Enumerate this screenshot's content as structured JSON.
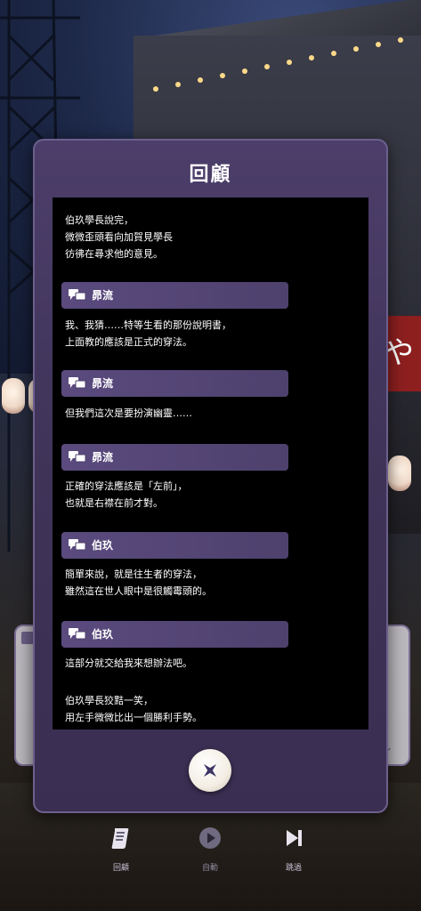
{
  "dialog": {
    "title": "回顧"
  },
  "log": [
    {
      "type": "text",
      "text": "伯玖學長說完，\n微微歪頭看向加賀見學長\n彷彿在尋求他的意見。"
    },
    {
      "type": "speaker",
      "name": "昴流"
    },
    {
      "type": "text",
      "text": "我、我猜……特等生看的那份說明書，\n上面教的應該是正式的穿法。"
    },
    {
      "type": "speaker",
      "name": "昴流"
    },
    {
      "type": "text",
      "text": "但我們這次是要扮演幽靈……"
    },
    {
      "type": "speaker",
      "name": "昴流"
    },
    {
      "type": "text",
      "text": "正確的穿法應該是「左前」，\n也就是右襟在前才對。"
    },
    {
      "type": "speaker",
      "name": "伯玖"
    },
    {
      "type": "text",
      "text": "簡單來說，就是往生者的穿法，\n雖然這在世人眼中是很觸霉頭的。"
    },
    {
      "type": "speaker",
      "name": "伯玖"
    },
    {
      "type": "text",
      "text": "這部分就交給我來想辦法吧。"
    },
    {
      "type": "text",
      "text": "伯玖學長狡黠一笑，\n用左手微微比出一個勝利手勢。"
    }
  ],
  "bottom_bar": {
    "log_label": "回顧",
    "auto_label": "自動",
    "skip_label": "跳過"
  },
  "colors": {
    "dialog_bg": "#3f3358",
    "speaker_bar": "#5a4a7e",
    "log_bg": "#000000"
  }
}
